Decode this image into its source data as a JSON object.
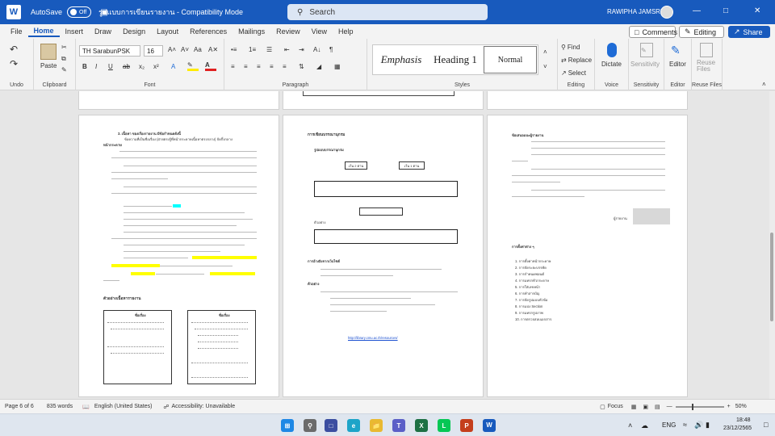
{
  "titlebar": {
    "autosave_label": "AutoSave",
    "autosave_state": "Off",
    "doc_title": "รูปแบบการเขียนรายงาน - Compatibility Mode",
    "search_placeholder": "Search",
    "user_name": "RAWIPHA JAMSRI"
  },
  "menu": {
    "tabs": [
      "File",
      "Home",
      "Insert",
      "Draw",
      "Design",
      "Layout",
      "References",
      "Mailings",
      "Review",
      "View",
      "Help"
    ],
    "active_tab": "Home",
    "comments_label": "Comments",
    "editing_label": "Editing",
    "share_label": "Share"
  },
  "ribbon": {
    "undo_label": "Undo",
    "clipboard_label": "Clipboard",
    "paste_label": "Paste",
    "font_name": "TH SarabunPSK",
    "font_size": "16",
    "font_label": "Font",
    "paragraph_label": "Paragraph",
    "styles_label": "Styles",
    "style_emphasis": "Emphasis",
    "style_heading1": "Heading 1",
    "style_normal": "Normal",
    "find_label": "Find",
    "replace_label": "Replace",
    "select_label": "Select",
    "editing_group_label": "Editing",
    "dictate_label": "Dictate",
    "voice_label": "Voice",
    "sensitivity_label": "Sensitivity",
    "sensitivity_group_label": "Sensitivity",
    "editor_label": "Editor",
    "editor_group_label": "Editor",
    "reuse_label": "Reuse Files",
    "reuse_group_label": "Reuse Files",
    "font_buttons": [
      "B",
      "I",
      "U",
      "ab",
      "x₂",
      "x²",
      "A"
    ]
  },
  "pages": {
    "p1_heading": "3. เนื้อหา ของเรื่องรายงาน มีข้อกำหนดดังนี้",
    "p1_line2": "ข้อความที่เป็นชื่อเรื่อง (ฝ่ายตรงรู้ที่หน้ากระดาษเนื้อหาตรงกลาง) จัดกึ่งกลาง",
    "p1_line3": "หน้ากระดาษ",
    "p1_example": "ตัวอย่างเนื้อหารายงาน",
    "p1_box_title": "ชื่อเรื่อง",
    "p1_box_title2": "ชื่อเรื่อง",
    "p2_heading": "การเขียนบรรณานุกรม",
    "p2_sub": "รูปแบบบรรณานุกรม",
    "p2_box_left": "เว้น 2 ตาน",
    "p2_box_right": "เว้น 1 ตาน",
    "p2_example": "ตัวอย่าง",
    "p2_ref_heading": "การอ้างอิงจากเว็บไซต์",
    "p2_example2": "ตัวอย่าง",
    "p2_url": "http://library.cmu.ac.th/resources/",
    "p3_heading": "ข้อเสนอแนะผู้รายงาน",
    "p3_sign": "ผู้รายงาน",
    "p3_list_heading": "การตั้งค่าต่าง ๆ",
    "p3_items": [
      "1. การตั้งค่าหน้ากระดาษ",
      "2. การจัดระยะบรรทัด",
      "3. การกำหนดฟอนต์",
      "4. การแทรกหัวกระดาษ",
      "5. การใส่เลขหน้า",
      "6. การทำสารบัญ",
      "7. การจัดรูปแบบหัวข้อ",
      "8. การแบ่ง Section",
      "9. การแทรกรูปภาพ",
      "10. การตรวจสอบเอกสาร"
    ]
  },
  "status": {
    "page": "Page 6 of 6",
    "words": "835 words",
    "language": "English (United States)",
    "accessibility": "Accessibility: Unavailable",
    "focus": "Focus",
    "zoom": "50%"
  },
  "taskbar": {
    "lang": "ENG",
    "time": "18:48",
    "date": "23/12/2565"
  },
  "colors": {
    "brand": "#185abd",
    "highlight_cyan": "#00ffff",
    "highlight_yellow": "#ffff00"
  }
}
